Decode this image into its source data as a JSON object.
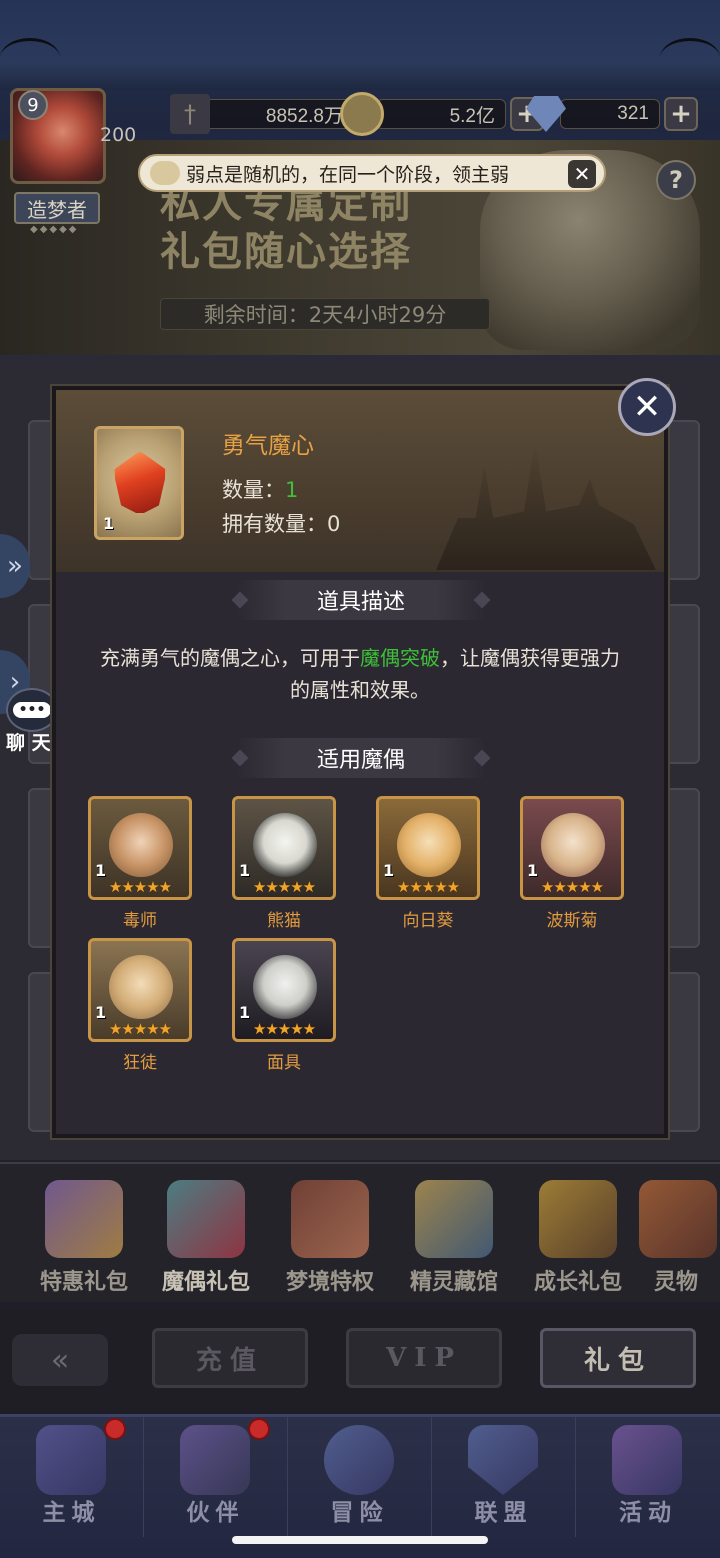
{
  "resources": {
    "power": "8852.8万",
    "gold": "5.2亿",
    "gems": "321",
    "plus": "+"
  },
  "avatar": {
    "level": "9",
    "count": "200",
    "title": "造梦者"
  },
  "tooltip": {
    "text": "弱点是随机的，在同一个阶段，领主弱",
    "close": "✕"
  },
  "banner": {
    "title_line1": "私人专属定制",
    "title_line2": "礼包随心选择",
    "remaining": "剩余时间：2天4小时29分",
    "help": "?"
  },
  "sidebar": {
    "chat_label": "聊 天",
    "chat_bubble": "•••",
    "expand_arrow": "»",
    "expand_arrow2": "›"
  },
  "item": {
    "name": "勇气魔心",
    "qty_label": "数量：",
    "qty_value": "1",
    "owned_label": "拥有数量：",
    "owned_value": "0",
    "icon_qty": "1"
  },
  "description": {
    "header": "道具描述",
    "text_before": "充满勇气的魔偶之心，可用于",
    "highlight": "魔偶突破",
    "text_after": "，让魔偶获得更强力的属性和效果。"
  },
  "puppets": {
    "header": "适用魔偶",
    "items": [
      {
        "name": "毒师",
        "num": "1",
        "stars": "★★★★★"
      },
      {
        "name": "熊猫",
        "num": "1",
        "stars": "★★★★★"
      },
      {
        "name": "向日葵",
        "num": "1",
        "stars": "★★★★★"
      },
      {
        "name": "波斯菊",
        "num": "1",
        "stars": "★★★★★"
      },
      {
        "name": "狂徒",
        "num": "1",
        "stars": "★★★★★"
      },
      {
        "name": "面具",
        "num": "1",
        "stars": "★★★★★"
      }
    ]
  },
  "categories": [
    "特惠礼包",
    "魔偶礼包",
    "梦境特权",
    "精灵藏馆",
    "成长礼包",
    "灵物"
  ],
  "tabs": {
    "back": "«",
    "recharge": "充值",
    "vip": "VIP",
    "gift": "礼包"
  },
  "nav": [
    "主城",
    "伙伴",
    "冒险",
    "联盟",
    "活动"
  ],
  "modal_close": "✕",
  "colors": {
    "accent_orange": "#e7a145",
    "green": "#3fbf3a",
    "gold_frame": "#c89445"
  }
}
